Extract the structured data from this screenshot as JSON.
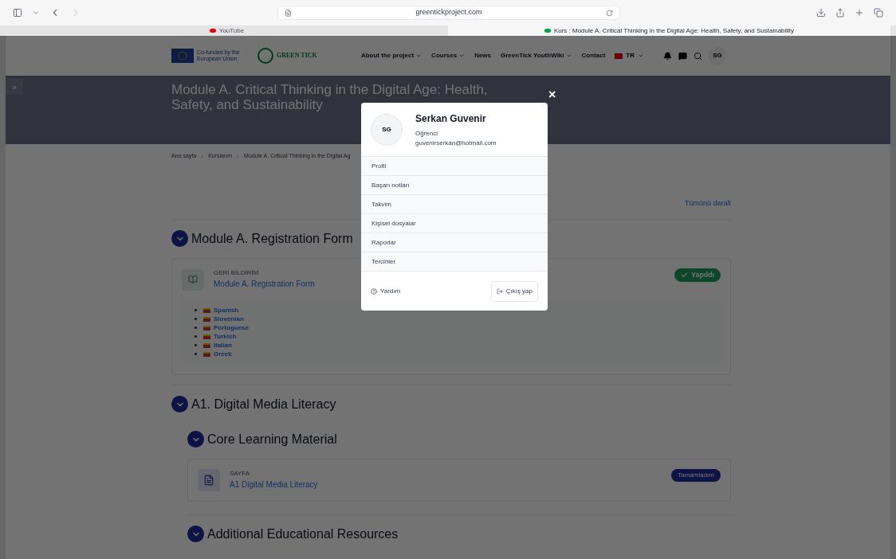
{
  "browser": {
    "url": "greentickproject.com",
    "tabs": [
      {
        "label": "YouTube",
        "selected": false
      },
      {
        "label": "Kurs : Module A. Critical Thinking in the Digital Age: Health, Safety, and Sustainability",
        "selected": true
      }
    ]
  },
  "navbar": {
    "eu_text": "Co-funded by the European Union",
    "brand": "GREEN TICK",
    "items": [
      {
        "label": "About the project",
        "dropdown": true
      },
      {
        "label": "Courses",
        "dropdown": true
      },
      {
        "label": "News",
        "dropdown": false
      },
      {
        "label": "GreenTick YouthWiki",
        "dropdown": true
      },
      {
        "label": "Contact",
        "dropdown": false
      }
    ],
    "language": "TR",
    "avatar": "SG"
  },
  "drawer_toggle": "»",
  "header": {
    "title": "Module A. Critical Thinking in the Digital Age: Health, Safety, and Sustainability"
  },
  "breadcrumb": [
    "Ana sayfa",
    "Kurslarım",
    "Module A. Critical Thinking in the Digital Ag"
  ],
  "collapse_all": "Tümünü daralt",
  "sections": [
    {
      "title": "Module A. Registration Form",
      "activities": [
        {
          "type": "GERİ BİLDİRİM",
          "name": "Module A. Registration Form",
          "status": "Yapıldı",
          "kind": "done",
          "languages": [
            "Spanish",
            "Slovenian",
            "Portuguese",
            "Turkish",
            "Italian",
            "Greek"
          ]
        }
      ]
    },
    {
      "title": "A1. Digital Media Literacy",
      "children": [
        {
          "title": "Core Learning Material",
          "activities": [
            {
              "type": "SAYFA",
              "name": "A1 Digital Media Literacy",
              "status": "Tamamladım",
              "kind": "manual"
            }
          ]
        },
        {
          "title": "Additional Educational Resources"
        }
      ]
    }
  ],
  "modal": {
    "close": "×",
    "initials": "SG",
    "name": "Serkan Guvenir",
    "role": "Öğrenci",
    "email": "guvenirserkan@hotmail.com",
    "items": [
      "Profil",
      "Başarı notları",
      "Takvim",
      "Kişisel dosyalar",
      "Raporlar",
      "Tercihler"
    ],
    "help": "Yardım",
    "logout": "Çıkış yap"
  }
}
